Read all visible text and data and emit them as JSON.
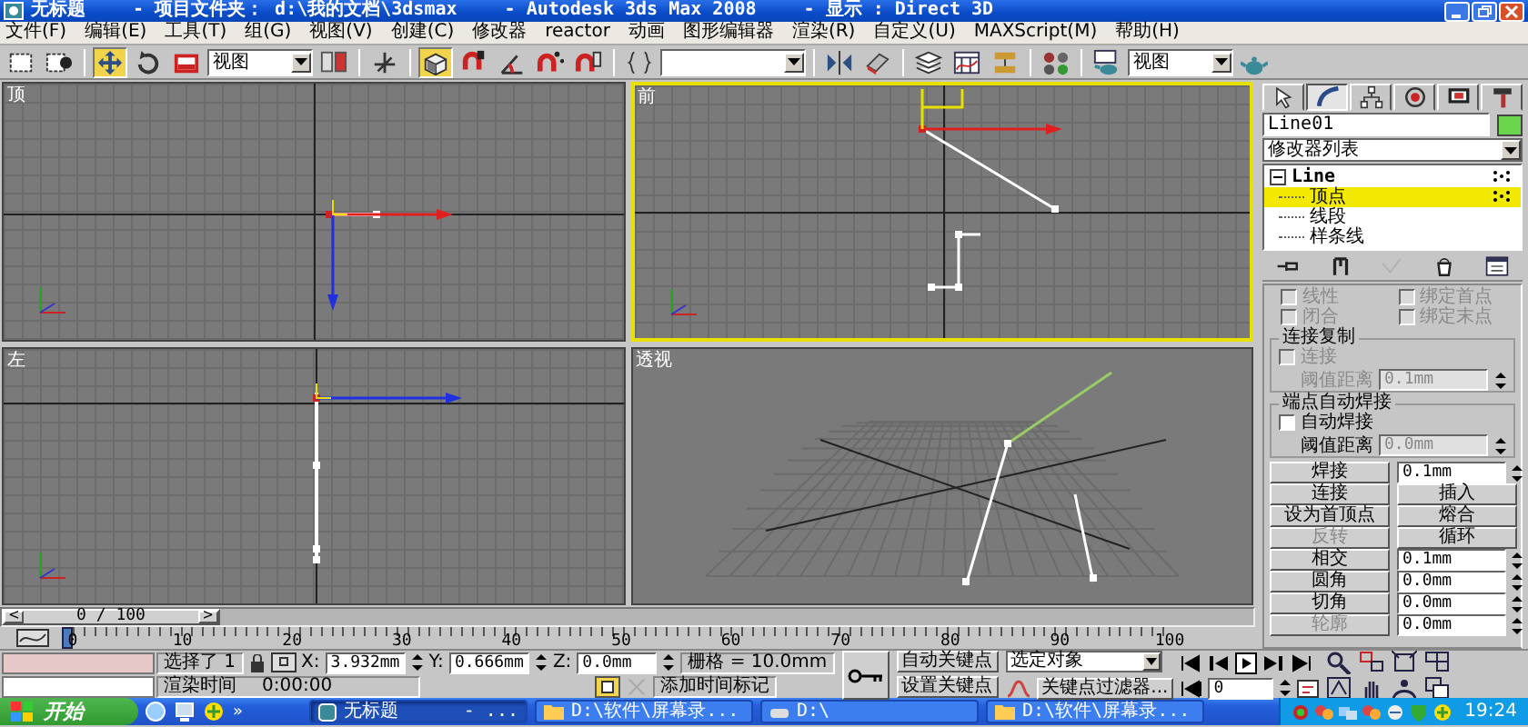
{
  "window": {
    "title_parts": [
      "无标题",
      "- 项目文件夹： d:\\我的文档\\3dsmax",
      "- Autodesk 3ds Max 2008",
      "- 显示 : Direct 3D"
    ]
  },
  "menu": [
    "文件(F)",
    "编辑(E)",
    "工具(T)",
    "组(G)",
    "视图(V)",
    "创建(C)",
    "修改器",
    "reactor",
    "动画",
    "图形编辑器",
    "渲染(R)",
    "自定义(U)",
    "MAXScript(M)",
    "帮助(H)"
  ],
  "toolbar": {
    "groups": [
      [
        {
          "kind": "rect-select",
          "selected": false
        },
        {
          "kind": "window-select",
          "selected": false
        }
      ],
      [
        {
          "kind": "move",
          "selected": true
        },
        {
          "kind": "rotate",
          "selected": false
        },
        {
          "kind": "scale",
          "selected": false
        },
        {
          "kind": "dropdown",
          "value": "视图"
        },
        {
          "kind": "pivot",
          "selected": false
        }
      ],
      [
        {
          "kind": "axis",
          "selected": false
        }
      ],
      [
        {
          "kind": "snap",
          "selected": true
        },
        {
          "kind": "snap3",
          "selected": false
        },
        {
          "kind": "angle",
          "selected": false
        },
        {
          "kind": "percent",
          "selected": false
        },
        {
          "kind": "spinner",
          "selected": false
        }
      ],
      [
        {
          "kind": "named",
          "selected": false
        },
        {
          "kind": "field"
        }
      ],
      [
        {
          "kind": "mirror",
          "selected": false
        },
        {
          "kind": "align",
          "selected": false
        }
      ],
      [
        {
          "kind": "layers",
          "selected": false
        },
        {
          "kind": "curve",
          "selected": false
        },
        {
          "kind": "schematic",
          "selected": false
        }
      ],
      [
        {
          "kind": "material",
          "selected": false
        }
      ],
      [
        {
          "kind": "render-setup",
          "selected": false
        },
        {
          "kind": "dropdown",
          "value": "视图"
        },
        {
          "kind": "render",
          "selected": false
        }
      ]
    ]
  },
  "viewports": [
    {
      "kind": "top",
      "label": "顶",
      "active": false
    },
    {
      "kind": "front",
      "label": "前",
      "active": true
    },
    {
      "kind": "left",
      "label": "左",
      "active": false
    },
    {
      "kind": "perspective",
      "label": "透视",
      "active": false
    }
  ],
  "command_panel": {
    "tabs": [
      {
        "kind": "create",
        "selected": false
      },
      {
        "kind": "modify",
        "selected": true
      },
      {
        "kind": "hierarchy",
        "selected": false
      },
      {
        "kind": "motion",
        "selected": false
      },
      {
        "kind": "display",
        "selected": false
      },
      {
        "kind": "utilities",
        "selected": false
      }
    ],
    "object_name": "Line01",
    "modifier_list": "修改器列表",
    "stack": [
      {
        "label": "Line",
        "expanded": true,
        "children": [
          {
            "label": "顶点",
            "selected": true
          },
          {
            "label": "线段",
            "selected": false
          },
          {
            "label": "样条线",
            "selected": false
          }
        ]
      }
    ],
    "stack_tools": [
      {
        "kind": "pin",
        "disabled": false
      },
      {
        "kind": "end-result",
        "disabled": false
      },
      {
        "kind": "make-unique",
        "disabled": true
      },
      {
        "kind": "remove",
        "disabled": false
      },
      {
        "kind": "configure",
        "disabled": false
      }
    ],
    "checkboxes": [
      {
        "label": "线性",
        "checked": false,
        "disabled": true
      },
      {
        "label": "绑定首点",
        "checked": false,
        "disabled": true
      },
      {
        "label": "闭合",
        "checked": false,
        "disabled": true
      },
      {
        "label": "绑定末点",
        "checked": false,
        "disabled": true
      }
    ],
    "groups": [
      {
        "title": "连接复制",
        "checkbox": {
          "label": "连接",
          "checked": false,
          "disabled": true
        },
        "field_label": "阈值距离",
        "label_disabled": true,
        "value": "0.1mm",
        "field_disabled": true
      },
      {
        "title": "端点自动焊接",
        "checkbox": {
          "label": "自动焊接",
          "checked": false,
          "disabled": false
        },
        "field_label": "阈值距离",
        "label_disabled": false,
        "value": "0.0mm",
        "field_disabled": true
      }
    ],
    "operations": [
      {
        "kind": "spinner",
        "button": {
          "label": "焊接",
          "disabled": false
        },
        "value": "0.1mm"
      },
      {
        "kind": "pair",
        "buttons": [
          {
            "label": "连接",
            "disabled": false
          },
          {
            "label": "插入",
            "disabled": false
          }
        ]
      },
      {
        "kind": "pair",
        "buttons": [
          {
            "label": "设为首顶点",
            "disabled": false
          },
          {
            "label": "熔合",
            "disabled": false
          }
        ]
      },
      {
        "kind": "pair",
        "buttons": [
          {
            "label": "反转",
            "disabled": true
          },
          {
            "label": "循环",
            "disabled": false
          }
        ]
      },
      {
        "kind": "spinner",
        "button": {
          "label": "相交",
          "disabled": false
        },
        "value": "0.1mm"
      },
      {
        "kind": "spinner",
        "button": {
          "label": "圆角",
          "disabled": false
        },
        "value": "0.0mm"
      },
      {
        "kind": "spinner",
        "button": {
          "label": "切角",
          "disabled": false
        },
        "value": "0.0mm"
      },
      {
        "kind": "spinner",
        "button": {
          "label": "轮廓",
          "disabled": true
        },
        "value": "0.0mm"
      }
    ]
  },
  "time_slider": {
    "prev": "<",
    "label": "0 / 100",
    "next": ">",
    "level": 0
  },
  "ruler": {
    "labels": [
      "0",
      "10",
      "20",
      "30",
      "40",
      "50",
      "60",
      "70",
      "80",
      "90",
      "100"
    ]
  },
  "status": {
    "selection": "选择了 1",
    "coords": [
      {
        "axis": "X:",
        "value": "3.932mm"
      },
      {
        "axis": "Y:",
        "value": "0.666mm"
      },
      {
        "axis": "Z:",
        "value": "0.0mm"
      }
    ],
    "grid": "栅格 = 10.0mm",
    "render_time_label": "渲染时间",
    "render_time": "0:00:00",
    "add_time_tag": "添加时间标记",
    "auto_key": "自动关键点",
    "set_key": "设置关键点",
    "key_mode": "选定对象",
    "key_filters": "关键点过滤器...",
    "frame": "0"
  },
  "taskbar": {
    "start": "开始",
    "more": "»",
    "tasks": [
      {
        "label": "无标题",
        "suffix": "- ...",
        "selected": true
      },
      {
        "label": "D:\\软件\\屏幕录...",
        "selected": false
      },
      {
        "label": "D:\\",
        "selected": false
      },
      {
        "label": "D:\\软件\\屏幕录...",
        "selected": false
      }
    ],
    "clock": "19:24"
  }
}
